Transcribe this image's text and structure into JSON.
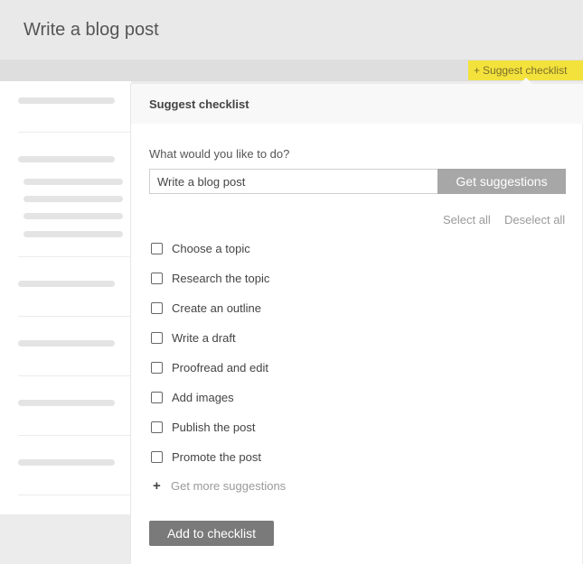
{
  "page": {
    "title": "Write a blog post"
  },
  "toolbar": {
    "suggest_plus": "+",
    "suggest_label": "Suggest checklist",
    "accent": "#f4e23c"
  },
  "panel": {
    "title": "Suggest checklist",
    "prompt_label": "What would you like to do?",
    "input_value": "Write a blog post",
    "get_button": "Get suggestions",
    "select_all": "Select all",
    "deselect_all": "Deselect all",
    "items": [
      {
        "label": "Choose a topic",
        "checked": false
      },
      {
        "label": "Research the topic",
        "checked": false
      },
      {
        "label": "Create an outline",
        "checked": false
      },
      {
        "label": "Write a draft",
        "checked": false
      },
      {
        "label": "Proofread and edit",
        "checked": false
      },
      {
        "label": "Add images",
        "checked": false
      },
      {
        "label": "Publish the post",
        "checked": false
      },
      {
        "label": "Promote the post",
        "checked": false
      }
    ],
    "more_icon": "plus-icon",
    "more_label": "Get more suggestions",
    "add_button": "Add to checklist"
  }
}
